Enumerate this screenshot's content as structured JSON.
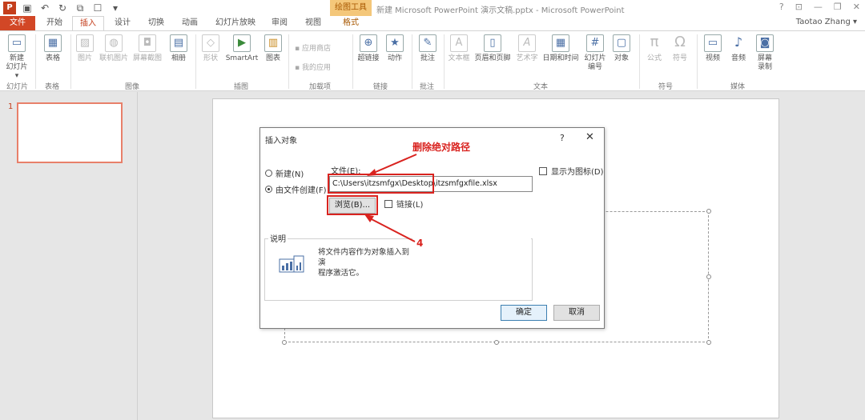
{
  "titlebar": {
    "app_icon": "P",
    "context_tab": "绘图工具",
    "doc_title": "新建 Microsoft PowerPoint 演示文稿.pptx - Microsoft PowerPoint",
    "help": "?",
    "restore": "⊡",
    "minimize": "—",
    "maximize": "❐",
    "close": "✕"
  },
  "tabs": [
    "文件",
    "开始",
    "插入",
    "设计",
    "切换",
    "动画",
    "幻灯片放映",
    "审阅",
    "视图",
    "格式"
  ],
  "user": "Taotao Zhang ▾",
  "ribbon": {
    "new_slide": "新建\n幻灯片 ▾",
    "table": "表格",
    "picture": "图片",
    "online_picture": "联机图片",
    "screenshot": "屏幕截图",
    "album": "相册",
    "shapes": "形状",
    "smartart": "SmartArt",
    "chart": "图表",
    "app_store": "应用商店",
    "my_apps": "我的应用",
    "hyperlink": "超链接",
    "action": "动作",
    "comment": "批注",
    "textbox": "文本框",
    "header_footer": "页眉和页脚",
    "wordart": "艺术字",
    "datetime": "日期和时间",
    "slide_number": "幻灯片\n编号",
    "object": "对象",
    "equation": "公式",
    "symbol": "符号",
    "video": "视频",
    "audio": "音频",
    "screen_recording": "屏幕\n录制",
    "groups": [
      "幻灯片",
      "表格",
      "图像",
      "插图",
      "加载项",
      "链接",
      "批注",
      "文本",
      "符号",
      "媒体"
    ]
  },
  "thumbnail": {
    "number": "1"
  },
  "dialog": {
    "title": "插入对象",
    "help": "?",
    "close": "✕",
    "new_option": "新建(N)",
    "from_file_option": "由文件创建(F)",
    "file_label": "文件(E):",
    "file_value": "C:\\Users\\itzsmfgx\\Desktop\\itzsmfgxfile.xlsx",
    "browse": "浏览(B)...",
    "link": "链接(L)",
    "show_icon": "显示为图标(D)",
    "description_label": "说明",
    "description_text": "将文件内容作为对象插入到演\n程序激活它。",
    "ok": "确定",
    "cancel": "取消"
  },
  "annotations": {
    "delete_path": "删除绝对路径",
    "step": "4"
  },
  "colors": {
    "accent": "#c43e1c",
    "annotation_red": "#d9231f",
    "context_tab_bg": "#f4c77a"
  }
}
